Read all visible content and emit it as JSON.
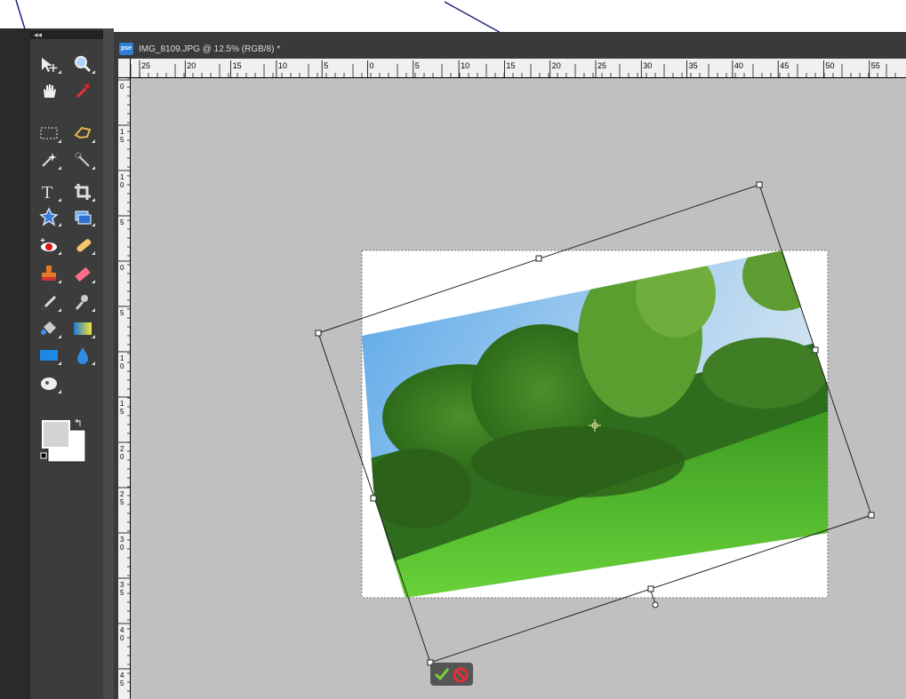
{
  "document": {
    "app_icon_label": "pse",
    "tab_title": "IMG_8109.JPG @ 12.5% (RGB/8) *"
  },
  "rulers": {
    "horizontal_labels": [
      "25",
      "20",
      "15",
      "10",
      "5",
      "0",
      "5",
      "10",
      "15",
      "20",
      "25",
      "30",
      "35",
      "40",
      "45",
      "50",
      "55"
    ],
    "vertical_labels": [
      "0",
      "1\n5",
      "1\n0",
      "5",
      "0",
      "5",
      "1\n0",
      "1\n5",
      "2\n0",
      "2\n5",
      "3\n0",
      "3\n5",
      "4\n0",
      "4\n5"
    ]
  },
  "toolbox": {
    "collapse_label": "◂◂",
    "tools": [
      {
        "name": "move-tool-icon"
      },
      {
        "name": "zoom-tool-icon"
      },
      {
        "name": "hand-tool-icon"
      },
      {
        "name": "eyedropper-tool-icon"
      },
      {
        "name": "marquee-tool-icon"
      },
      {
        "name": "lasso-tool-icon"
      },
      {
        "name": "magic-wand-tool-icon"
      },
      {
        "name": "quick-selection-tool-icon"
      },
      {
        "name": "type-tool-icon"
      },
      {
        "name": "crop-tool-icon"
      },
      {
        "name": "cookie-cutter-tool-icon"
      },
      {
        "name": "straighten-tool-icon"
      },
      {
        "name": "red-eye-tool-icon"
      },
      {
        "name": "healing-brush-tool-icon"
      },
      {
        "name": "clone-stamp-tool-icon"
      },
      {
        "name": "eraser-tool-icon"
      },
      {
        "name": "brush-tool-icon"
      },
      {
        "name": "smart-brush-tool-icon"
      },
      {
        "name": "paint-bucket-tool-icon"
      },
      {
        "name": "gradient-tool-icon"
      },
      {
        "name": "rectangle-shape-tool-icon"
      },
      {
        "name": "blur-tool-icon"
      },
      {
        "name": "sponge-tool-icon"
      }
    ],
    "foreground_color": "#d4d4d4",
    "background_color": "#ffffff"
  },
  "transform": {
    "commit_label": "✓",
    "cancel_label": "⊘"
  },
  "colors": {
    "annotation_arrow": "#1a237e",
    "canvas_bg": "#c0c0c0",
    "toolbox_bg": "#3c3c3c"
  }
}
